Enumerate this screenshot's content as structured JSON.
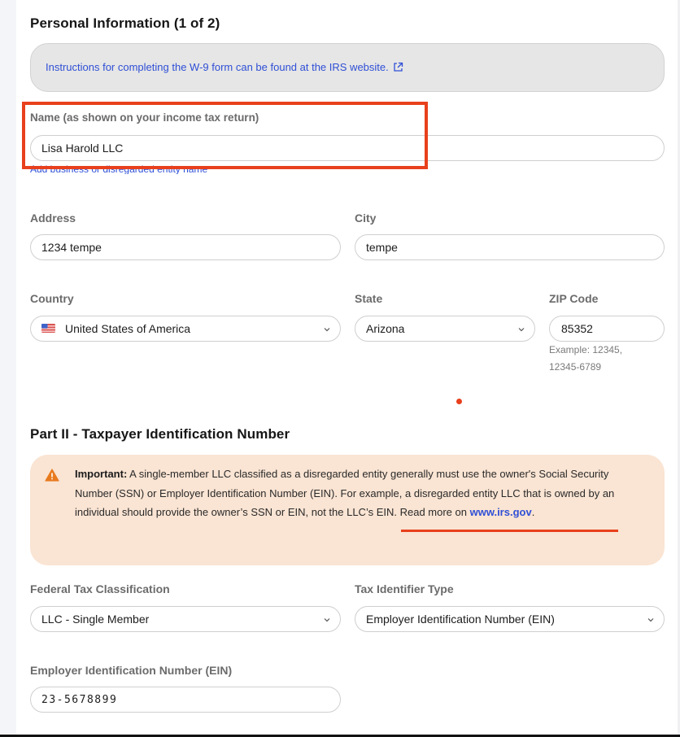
{
  "section1": {
    "title": "Personal Information (1 of 2)",
    "info_link_text": "Instructions for completing the W-9 form can be found at the IRS website.",
    "info_link_icon": "external-link-icon"
  },
  "name_field": {
    "label": "Name (as shown on your income tax return)",
    "value": "Lisa Harold LLC",
    "helper_link": "Add business or disregarded entity name"
  },
  "address_field": {
    "label": "Address",
    "value": "1234 tempe"
  },
  "city_field": {
    "label": "City",
    "value": "tempe"
  },
  "country_field": {
    "label": "Country",
    "value": "United States of America",
    "flag_icon": "us-flag-icon"
  },
  "state_field": {
    "label": "State",
    "value": "Arizona"
  },
  "zip_field": {
    "label": "ZIP Code",
    "value": "85352",
    "hint_line1": "Example: 12345,",
    "hint_line2": "12345-6789"
  },
  "section2": {
    "title": "Part II - Taxpayer Identification Number"
  },
  "warning": {
    "icon": "warning-triangle-icon",
    "strong": "Important:",
    "text_before_link": " A single-member LLC classified as a disregarded entity generally must use the owner's Social Security Number (SSN) or Employer Identification Number (EIN). For example, a disregarded entity LLC that is owned by an individual should provide the owner’s SSN or EIN, not the LLC’s EIN. Read more on ",
    "link_text": "www.irs.gov",
    "text_after_link": "."
  },
  "tax_classification_field": {
    "label": "Federal Tax Classification",
    "value": "LLC - Single Member"
  },
  "tax_identifier_type_field": {
    "label": "Tax Identifier Type",
    "value": "Employer Identification Number (EIN)"
  },
  "ein_field": {
    "label": "Employer Identification Number (EIN)",
    "value": "23-5678899"
  },
  "colors": {
    "accent_link": "#2f4fd6",
    "annotation_red": "#e8401c",
    "warning_bg": "#fae4d3",
    "warning_icon": "#e87a1e",
    "info_bg": "#e6e6e6"
  }
}
